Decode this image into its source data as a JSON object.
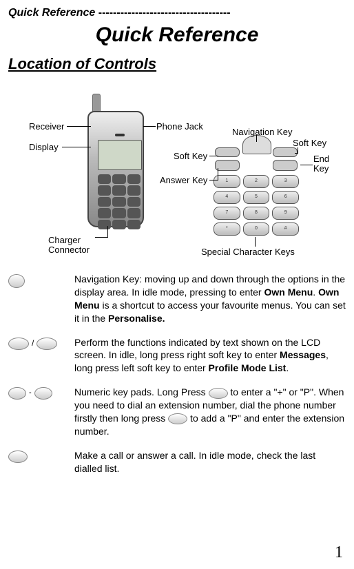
{
  "header": {
    "running_title": "Quick Reference",
    "dashes": "------------------------------------"
  },
  "main_title": "Quick Reference",
  "section_title": "Location of Controls",
  "labels": {
    "receiver": "Receiver",
    "display": "Display",
    "charger_connector_line1": "Charger",
    "charger_connector_line2": "Connector",
    "phone_jack": "Phone Jack",
    "navigation_key": "Navigation Key",
    "soft_key_left": "Soft Key",
    "soft_key_right": "Soft Key",
    "answer_key": "Answer Key",
    "end_key_line1": "End",
    "end_key_line2": "Key",
    "special_character_keys": "Special Character Keys"
  },
  "descriptions": {
    "nav": {
      "pre": "Navigation Key: moving up and down through the options in the display area. In idle mode, pressing to enter ",
      "bold1": "Own Menu",
      "mid1": ". ",
      "bold2": "Own Menu",
      "mid2": " is a shortcut to access your favourite menus. You can set it in the ",
      "bold3": "Personalise."
    },
    "softkeys": {
      "pre": "Perform the functions indicated by text shown on the LCD screen. In idle, long press right soft key to enter ",
      "bold1": "Messages",
      "mid1": ", long press left soft key to enter ",
      "bold2": "Profile Mode List",
      "post": "."
    },
    "numeric": {
      "part1": "Numeric key pads. Long Press ",
      "part2": " to enter a \"+\" or \"P\". When you need to dial an extension number, dial the phone number firstly then long press ",
      "part3": " to add a \"P\" and enter the extension number."
    },
    "call": "Make a call or answer a call. In idle mode, check the last dialled list."
  },
  "page_number": "1"
}
